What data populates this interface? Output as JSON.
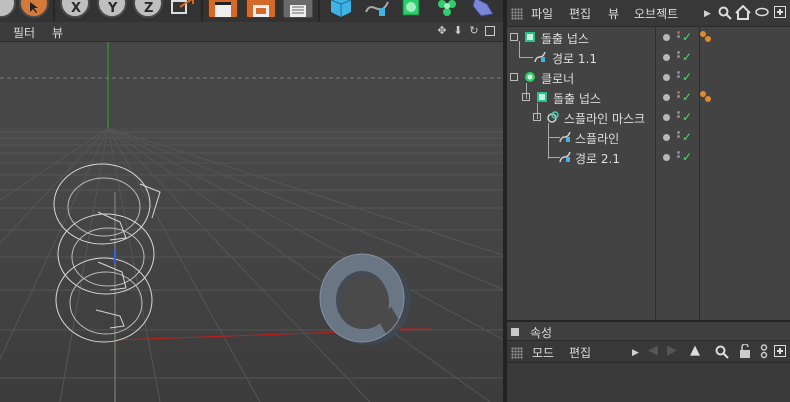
{
  "viewport": {
    "menu": {
      "filter": "필터",
      "view": "뷰"
    }
  },
  "toolbar": {
    "axis_buttons": [
      "X",
      "Y",
      "Z"
    ]
  },
  "object_manager": {
    "menu": {
      "file": "파일",
      "edit": "편집",
      "view": "뷰",
      "objects": "오브젝트"
    },
    "objects": [
      {
        "label": "돌출 넙스",
        "icon": "extrude-nurbs-icon",
        "tag": true
      },
      {
        "label": "경로 1.1",
        "icon": "spline-icon",
        "tag": false
      },
      {
        "label": "클로너",
        "icon": "cloner-icon",
        "tag": false
      },
      {
        "label": "돌출 넙스",
        "icon": "extrude-nurbs-icon",
        "tag": true
      },
      {
        "label": "스플라인 마스크",
        "icon": "spline-mask-icon",
        "tag": false
      },
      {
        "label": "스플라인",
        "icon": "spline-icon",
        "tag": false
      },
      {
        "label": "경로 2.1",
        "icon": "spline-icon",
        "tag": false
      }
    ]
  },
  "attribute_manager": {
    "title": "속성",
    "menu": {
      "mode": "모드",
      "edit": "편집"
    }
  },
  "colors": {
    "accent_orange": "#d46a2a",
    "check_green": "#4fd86a",
    "object_teal": "#3fd1b0",
    "x_axis_red": "#c02020",
    "y_axis_green": "#2eaa2e"
  }
}
